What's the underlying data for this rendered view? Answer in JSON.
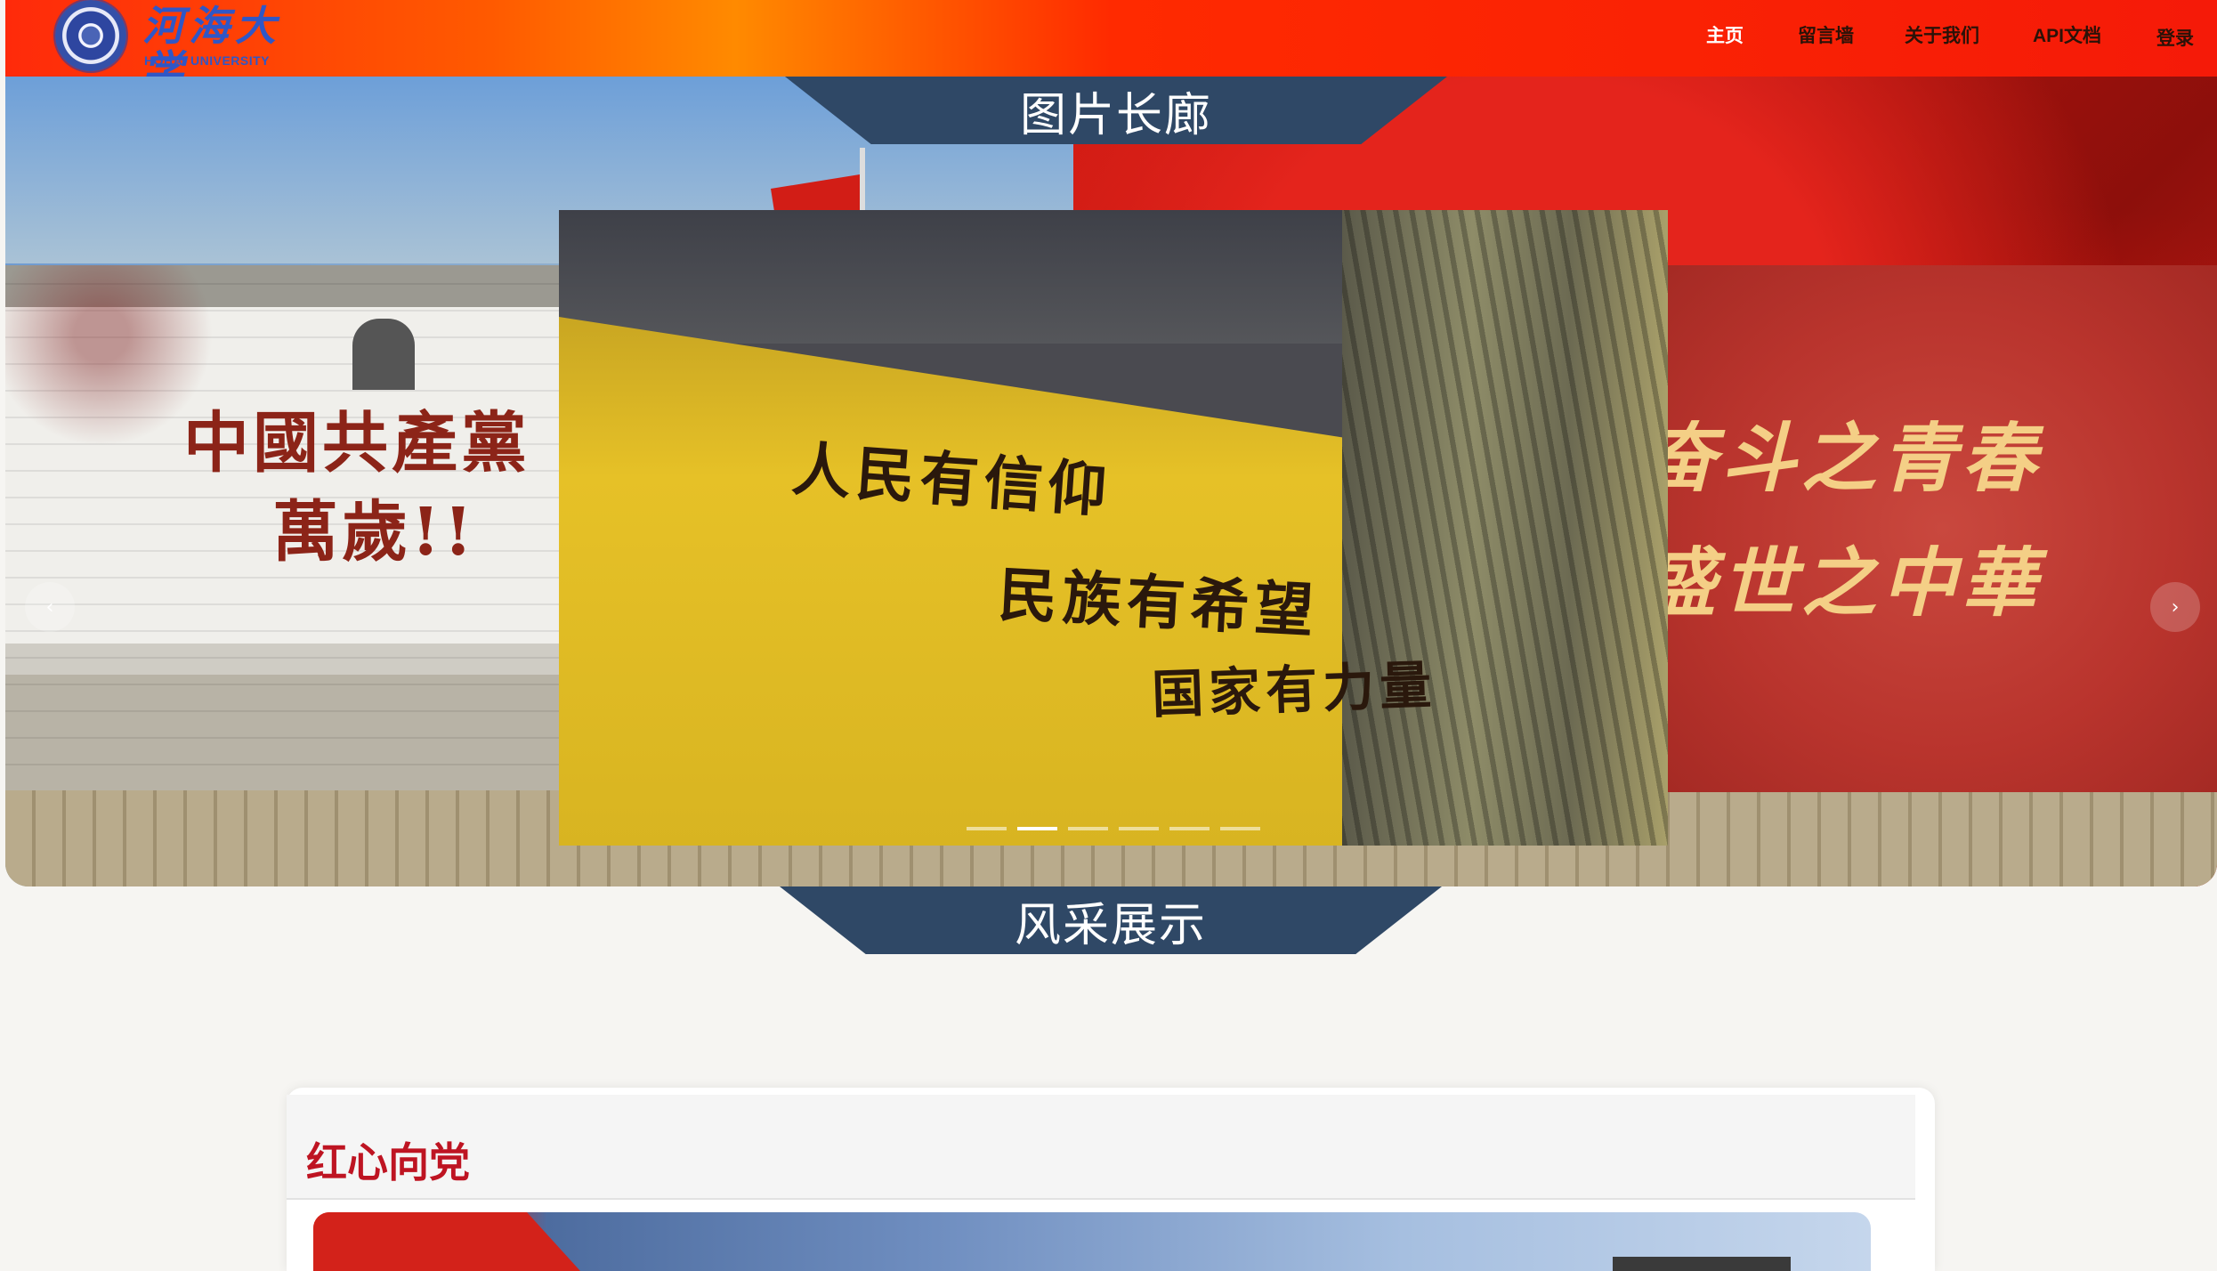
{
  "header": {
    "logo_name": "河海大学",
    "logo_subtitle": "HOHAI UNIVERSITY",
    "nav": [
      {
        "label": "主页",
        "active": true
      },
      {
        "label": "留言墙",
        "active": false
      },
      {
        "label": "关于我们",
        "active": false
      },
      {
        "label": "API文档",
        "active": false
      },
      {
        "label": "登录",
        "active": false
      }
    ],
    "gradient_colors": [
      "#ff2a0a",
      "#ff8a00",
      "#f51a08"
    ]
  },
  "gallery": {
    "title": "图片长廊",
    "prev_icon": "‹",
    "next_icon": "›",
    "slides": {
      "left_text": [
        "中國共產黨",
        "萬歲!!"
      ],
      "center_lines": [
        "人民有信仰",
        "民族有希望",
        "国家有力量"
      ],
      "right_lines": [
        "奋斗之青春",
        "盛世之中華"
      ]
    },
    "indicators": 6,
    "active_indicator": 2
  },
  "showcase": {
    "title": "风采展示",
    "card_title": "红心向党",
    "accent_color": "#be1422",
    "tab_color": "#2f4866"
  }
}
